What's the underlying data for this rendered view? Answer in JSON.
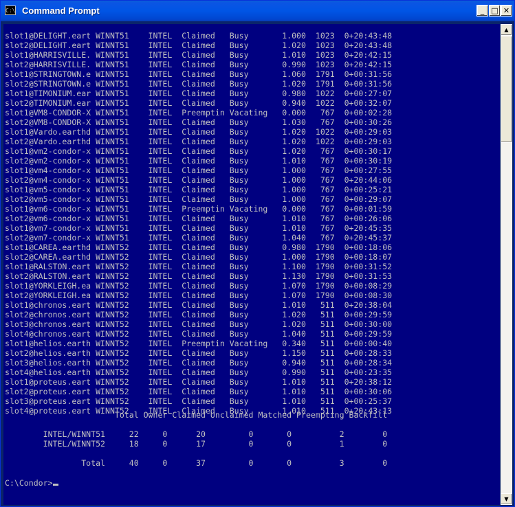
{
  "window": {
    "title": "Command Prompt",
    "icon_label": "C:\\",
    "minimize_glyph": "_",
    "maximize_glyph": "□",
    "close_glyph": "✕"
  },
  "console": {
    "rows": [
      "slot1@DELIGHT.eart WINNT51    INTEL  Claimed   Busy       1.000  1023  0+20:43:48",
      "slot2@DELIGHT.eart WINNT51    INTEL  Claimed   Busy       1.020  1023  0+20:43:48",
      "slot1@HARRISVILLE. WINNT51    INTEL  Claimed   Busy       1.010  1023  0+20:42:15",
      "slot2@HARRISVILLE. WINNT51    INTEL  Claimed   Busy       0.990  1023  0+20:42:15",
      "slot1@STRINGTOWN.e WINNT51    INTEL  Claimed   Busy       1.060  1791  0+00:31:56",
      "slot2@STRINGTOWN.e WINNT51    INTEL  Claimed   Busy       1.020  1791  0+00:31:56",
      "slot1@TIMONIUM.ear WINNT51    INTEL  Claimed   Busy       0.980  1022  0+00:27:07",
      "slot2@TIMONIUM.ear WINNT51    INTEL  Claimed   Busy       0.940  1022  0+00:32:07",
      "slot1@VM8-CONDOR-X WINNT51    INTEL  Preemptin Vacating   0.000   767  0+00:02:28",
      "slot2@VM8-CONDOR-X WINNT51    INTEL  Claimed   Busy       1.030   767  0+00:30:26",
      "slot1@Vardo.earthd WINNT51    INTEL  Claimed   Busy       1.020  1022  0+00:29:03",
      "slot2@Vardo.earthd WINNT51    INTEL  Claimed   Busy       1.020  1022  0+00:29:03",
      "slot1@vm2-condor-x WINNT51    INTEL  Claimed   Busy       1.020   767  0+00:30:17",
      "slot2@vm2-condor-x WINNT51    INTEL  Claimed   Busy       1.010   767  0+00:30:19",
      "slot1@vm4-condor-x WINNT51    INTEL  Claimed   Busy       1.000   767  0+00:27:55",
      "slot2@vm4-condor-x WINNT51    INTEL  Claimed   Busy       1.000   767  0+20:44:06",
      "slot1@vm5-condor-x WINNT51    INTEL  Claimed   Busy       1.000   767  0+00:25:21",
      "slot2@vm5-condor-x WINNT51    INTEL  Claimed   Busy       1.000   767  0+00:29:07",
      "slot1@vm6-condor-x WINNT51    INTEL  Preemptin Vacating   0.000   767  0+00:01:59",
      "slot2@vm6-condor-x WINNT51    INTEL  Claimed   Busy       1.010   767  0+00:26:06",
      "slot1@vm7-condor-x WINNT51    INTEL  Claimed   Busy       1.010   767  0+20:45:35",
      "slot2@vm7-condor-x WINNT51    INTEL  Claimed   Busy       1.040   767  0+20:45:37",
      "slot1@CAREA.earthd WINNT52    INTEL  Claimed   Busy       0.980  1790  0+00:18:06",
      "slot2@CAREA.earthd WINNT52    INTEL  Claimed   Busy       1.000  1790  0+00:18:07",
      "slot1@RALSTON.eart WINNT52    INTEL  Claimed   Busy       1.100  1790  0+00:31:52",
      "slot2@RALSTON.eart WINNT52    INTEL  Claimed   Busy       1.130  1790  0+00:31:53",
      "slot1@YORKLEIGH.ea WINNT52    INTEL  Claimed   Busy       1.070  1790  0+00:08:29",
      "slot2@YORKLEIGH.ea WINNT52    INTEL  Claimed   Busy       1.070  1790  0+00:08:30",
      "slot1@chronos.eart WINNT52    INTEL  Claimed   Busy       1.010   511  0+20:38:04",
      "slot2@chronos.eart WINNT52    INTEL  Claimed   Busy       1.020   511  0+00:29:59",
      "slot3@chronos.eart WINNT52    INTEL  Claimed   Busy       1.020   511  0+00:30:00",
      "slot4@chronos.eart WINNT52    INTEL  Claimed   Busy       1.040   511  0+00:29:59",
      "slot1@helios.earth WINNT52    INTEL  Preemptin Vacating   0.340   511  0+00:00:40",
      "slot2@helios.earth WINNT52    INTEL  Claimed   Busy       1.150   511  0+00:28:33",
      "slot3@helios.earth WINNT52    INTEL  Claimed   Busy       0.940   511  0+00:28:34",
      "slot4@helios.earth WINNT52    INTEL  Claimed   Busy       0.990   511  0+00:23:35",
      "slot1@proteus.eart WINNT52    INTEL  Claimed   Busy       1.010   511  0+20:38:12",
      "slot2@proteus.eart WINNT52    INTEL  Claimed   Busy       1.010   511  0+00:30:06",
      "slot3@proteus.eart WINNT52    INTEL  Claimed   Busy       1.010   511  0+00:25:37",
      "slot4@proteus.eart WINNT52    INTEL  Claimed   Busy       1.010   511  0+20:43:13"
    ],
    "summary_header": "                       Total Owner Claimed Unclaimed Matched Preempting Backfill",
    "summary_rows": [
      "        INTEL/WINNT51     22     0      20         0       0          2        0",
      "        INTEL/WINNT52     18     0      17         0       0          1        0"
    ],
    "total_row": "                Total     40     0      37         0       0          3        0",
    "prompt": "C:\\Condor>"
  }
}
